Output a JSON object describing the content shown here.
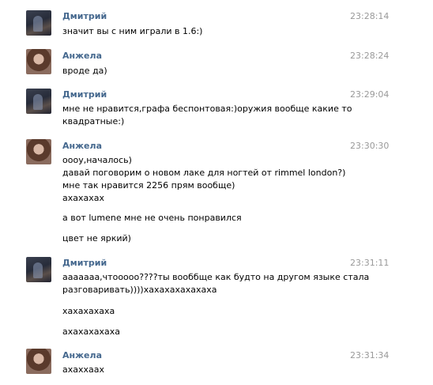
{
  "messages": [
    {
      "author": "Дмитрий",
      "avatar": "dmitry",
      "time": "23:28:14",
      "lines": [
        "значит вы с ним играли в 1.6:)"
      ]
    },
    {
      "author": "Анжела",
      "avatar": "anzhela",
      "time": "23:28:24",
      "lines": [
        "вроде да)"
      ]
    },
    {
      "author": "Дмитрий",
      "avatar": "dmitry",
      "time": "23:29:04",
      "lines": [
        "мне не нравится,графа беспонтовая:)оружия вообще какие то",
        "квадратные:)"
      ]
    },
    {
      "author": "Анжела",
      "avatar": "anzhela",
      "time": "23:30:30",
      "lines": [
        "оооу,началось)",
        "давай поговорим о новом лаке для ногтей от rimmel london?)",
        "мне так нравится 2256 прям вообще)",
        "ахахахах",
        "а вот lumene мне не очень понравился",
        "цвет не яркий)"
      ]
    },
    {
      "author": "Дмитрий",
      "avatar": "dmitry",
      "time": "23:31:11",
      "lines": [
        "ааааааа,чтооооо????ты вооббще как будто на другом языке стала",
        "разговаривать))))хахахахахахаха",
        "хахахахаха",
        "ахахахахаха"
      ]
    },
    {
      "author": "Анжела",
      "avatar": "anzhela",
      "time": "23:31:34",
      "lines": [
        "ахаххаах"
      ]
    }
  ]
}
